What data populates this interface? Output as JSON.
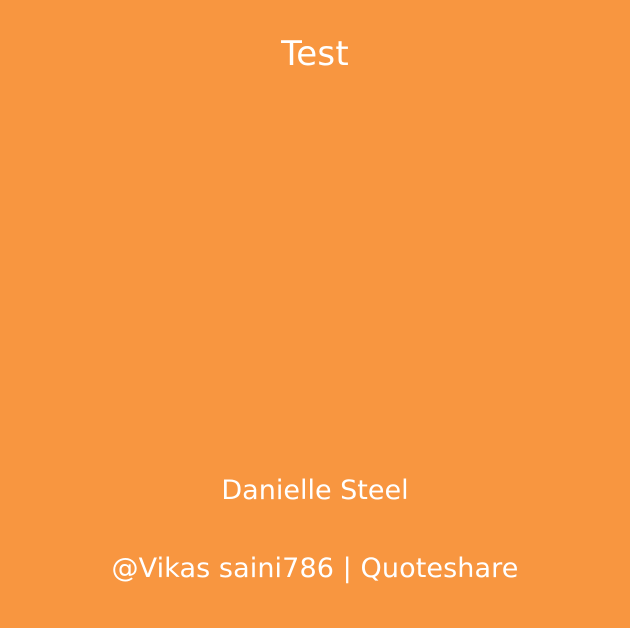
{
  "card": {
    "background_color": "#f89640",
    "text_color": "#ffffff",
    "quote_text": "Test",
    "author_name": "Danielle Steel",
    "footer_credit": "@Vikas saini786 | Quoteshare"
  }
}
